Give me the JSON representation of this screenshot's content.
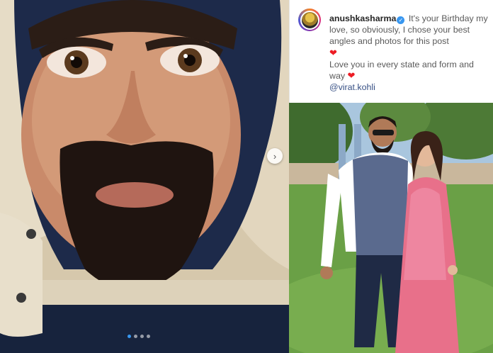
{
  "post": {
    "username": "anushkasharma",
    "verified_icon": "verified-badge-icon",
    "caption_line1": "It's your Birthday my love, so obviously, I chose your best angles and photos for this post",
    "caption_line2": "Love you in every state and form and way",
    "heart_icon": "heart-icon",
    "mention": "@virat.kohli",
    "carousel": {
      "slide_count": 4,
      "active_index": 0
    },
    "colors": {
      "heart": "#ed1c24",
      "verified": "#3897f0",
      "mention": "#385185"
    }
  }
}
